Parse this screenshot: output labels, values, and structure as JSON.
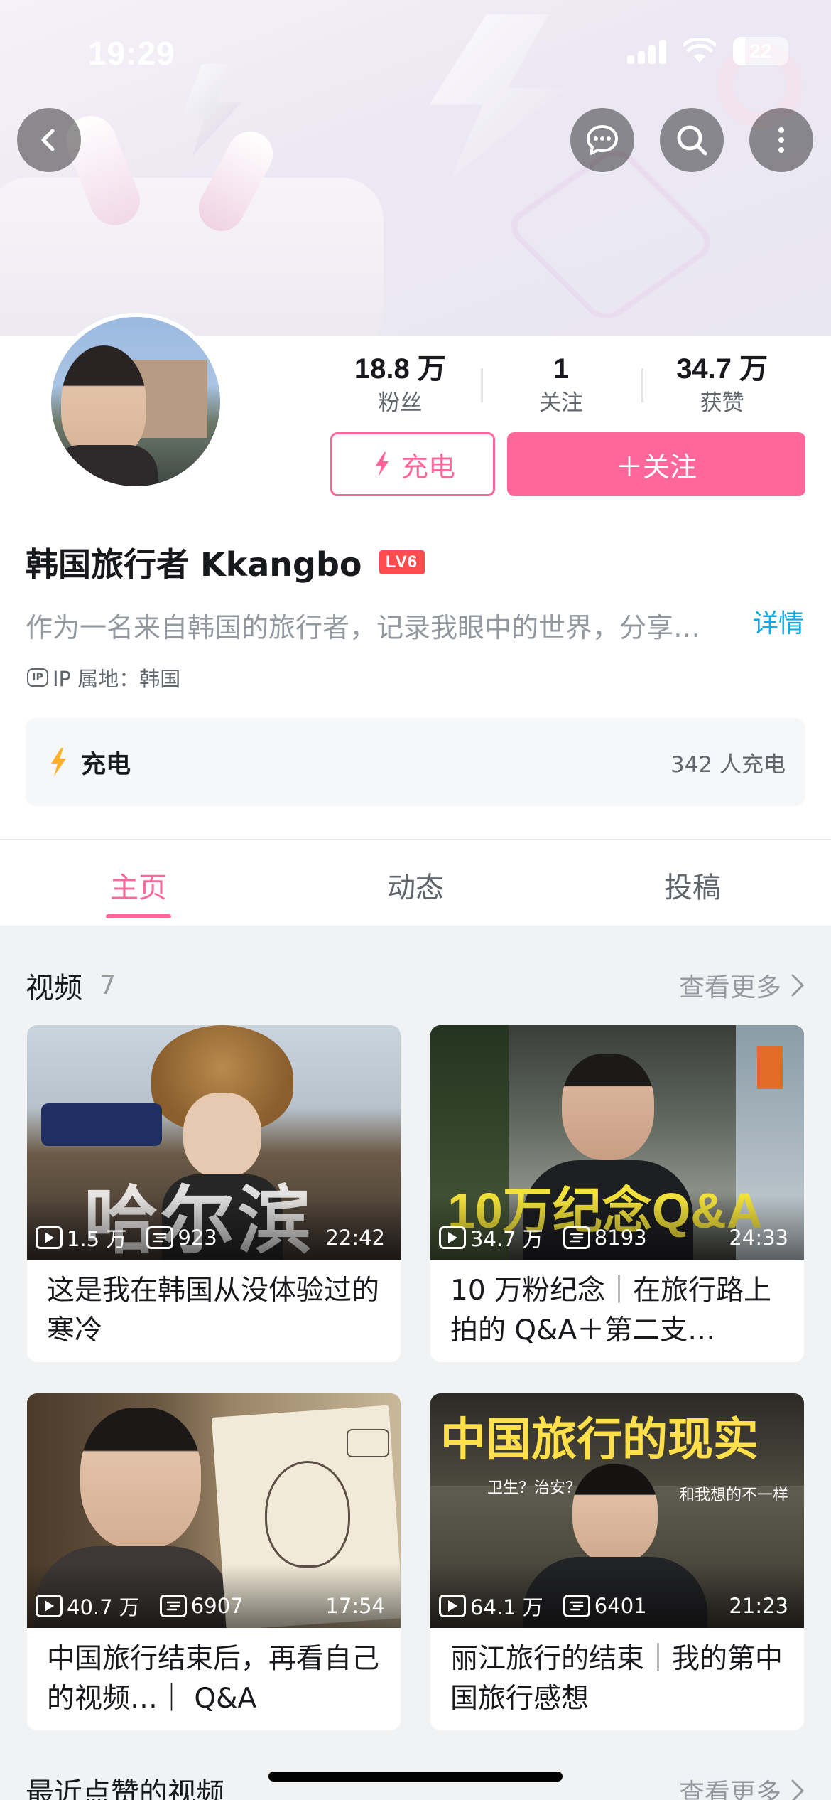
{
  "status": {
    "time": "19:29",
    "battery": "22"
  },
  "profile": {
    "name": "韩国旅行者 Kkangbo",
    "level": "LV6",
    "bio": "作为一名来自韩国的旅行者，记录我眼中的世界，分享…",
    "bio_more": "详情",
    "ip_badge": "IP",
    "ip": "IP 属地：韩国",
    "stats": [
      {
        "value": "18.8 万",
        "label": "粉丝"
      },
      {
        "value": "1",
        "label": "关注"
      },
      {
        "value": "34.7 万",
        "label": "获赞"
      }
    ],
    "charge_button": "充电",
    "follow_button": "＋关注"
  },
  "charge_card": {
    "title": "充电",
    "count": "342 人充电"
  },
  "tabs": [
    {
      "label": "主页",
      "active": true
    },
    {
      "label": "动态",
      "active": false
    },
    {
      "label": "投稿",
      "active": false
    }
  ],
  "videos_section": {
    "title": "视频",
    "count": "7",
    "more": "查看更多"
  },
  "videos": [
    {
      "views": "1.5 万",
      "comments": "923",
      "duration": "22:42",
      "title": "这是我在韩国从没体验过的寒冷",
      "overlay": "哈尔滨"
    },
    {
      "views": "34.7 万",
      "comments": "8193",
      "duration": "24:33",
      "title": "10 万粉纪念｜在旅行路上拍的 Q&A＋第二支…",
      "overlay": "10万纪念Q&A"
    },
    {
      "views": "40.7 万",
      "comments": "6907",
      "duration": "17:54",
      "title": "中国旅行结束后，再看自己的视频…｜ Q&A",
      "overlay": ""
    },
    {
      "views": "64.1 万",
      "comments": "6401",
      "duration": "21:23",
      "title": "丽江旅行的结束｜我的第中国旅行感想",
      "overlay": "中国旅行的现实",
      "overlay_sub1": "卫生？治安？",
      "overlay_sub2": "和我想的不一样"
    }
  ],
  "liked_section": {
    "title": "最近点赞的视频",
    "more": "查看更多"
  }
}
